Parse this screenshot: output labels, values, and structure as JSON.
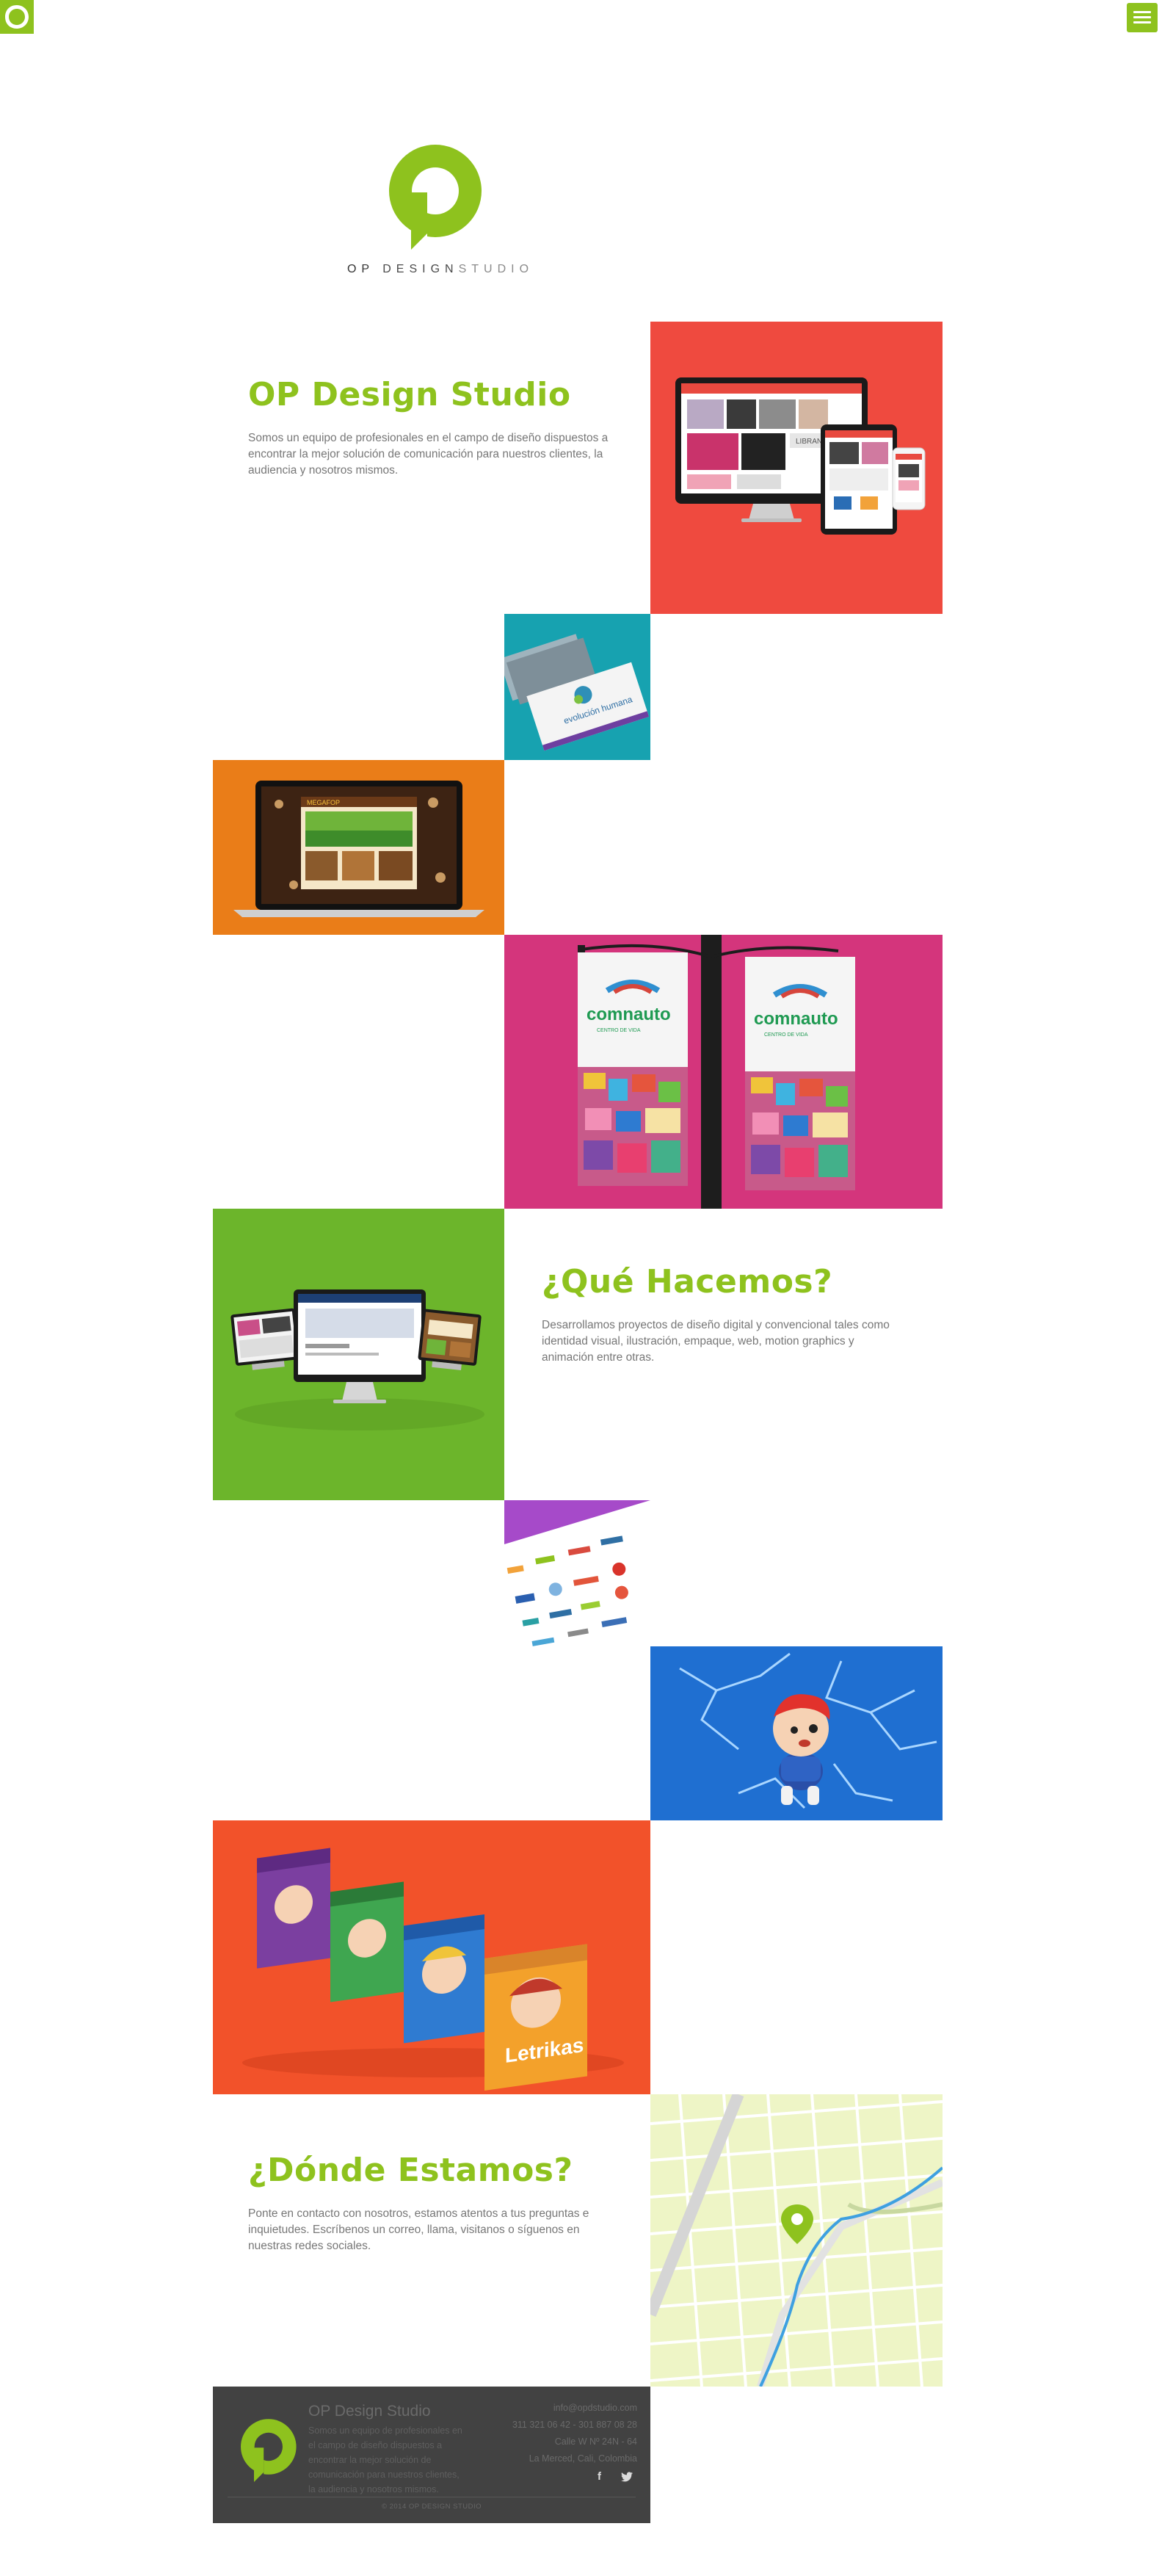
{
  "brand": {
    "name_part1": "OP",
    "name_part2": "DESIGN",
    "name_part3": "STUDIO"
  },
  "icons": {
    "corner_logo": "op-logo-icon",
    "menu": "hamburger-menu-icon",
    "facebook": "facebook-icon",
    "twitter": "twitter-icon",
    "map_pin": "map-pin-icon"
  },
  "colors": {
    "brand_green": "#8ec21e",
    "footer_bg": "#424242"
  },
  "intro": {
    "title": "OP Design Studio",
    "text": "Somos un equipo de profesionales en el campo de diseño dispuestos a encontrar la mejor solución de comunicación para nuestros clientes, la audiencia y nosotros mismos."
  },
  "services": {
    "title": "¿Qué Hacemos?",
    "text": "Desarrollamos proyectos de diseño digital y convencional tales como identidad visual, ilustración, empaque, web, motion graphics y animación entre otras."
  },
  "location": {
    "title": "¿Dónde Estamos?",
    "text": "Ponte en contacto con nosotros, estamos atentos a tus preguntas e inquietudes. Escríbenos un correo, llama, visitanos o síguenos en nuestras redes sociales."
  },
  "footer": {
    "title": "OP Design Studio",
    "text": "Somos un equipo de profesionales en el campo de diseño dispuestos a encontrar la mejor solución de comunicación para nuestros clientes, la audiencia y nosotros mismos.",
    "email": "info@opdstudio.com",
    "phones": "311 321 06 42 - 301 887 08 28",
    "address": "Calle W Nº 24N - 64",
    "city": "La Merced, Cali, Colombia",
    "copyright": "© 2014 OP DESIGN STUDIO"
  },
  "portfolio": {
    "tile1_brand": "LIBRANCHE",
    "tile2_brand": "evolución humana",
    "tile3_brand": "MEGAFOP",
    "tile4_brand": "comnauto",
    "tile4_brand_b": "comnauto",
    "tile4_sub": "CENTRO DE VIDA",
    "tile4_sub_b": "CENTRO DE VIDA",
    "tile8_brand": "Letrikas"
  }
}
